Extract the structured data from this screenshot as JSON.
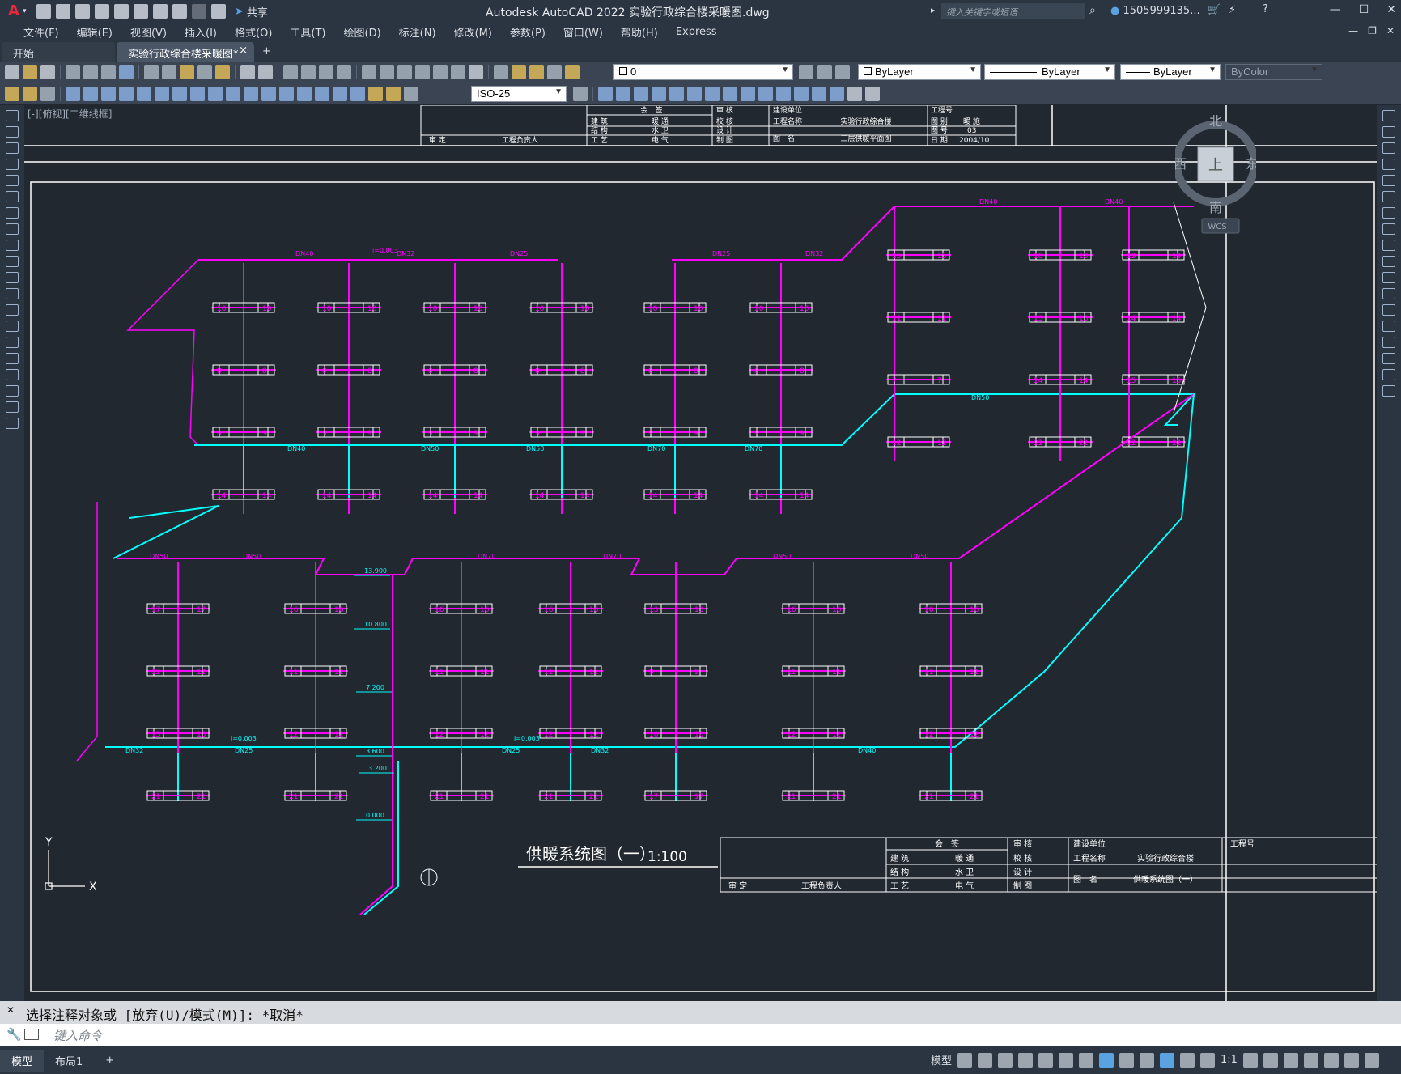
{
  "app": {
    "title": "Autodesk AutoCAD 2022    实验行政综合楼采暖图.dwg",
    "share_label": "共享",
    "search_placeholder": "键入关键字或短语",
    "user": "1505999135...",
    "logo": "A"
  },
  "menu": [
    "文件(F)",
    "编辑(E)",
    "视图(V)",
    "插入(I)",
    "格式(O)",
    "工具(T)",
    "绘图(D)",
    "标注(N)",
    "修改(M)",
    "参数(P)",
    "窗口(W)",
    "帮助(H)",
    "Express"
  ],
  "tabs": {
    "start": "开始",
    "active": "实验行政综合楼采暖图*",
    "close": "×",
    "new": "+"
  },
  "props": {
    "layer": "0",
    "color": "ByLayer",
    "linetype": "ByLayer",
    "lineweight": "ByLayer",
    "plotstyle": "ByColor",
    "dimstyle": "ISO-25"
  },
  "viewport_label": "[-][俯视][二维线框]",
  "viewcube": {
    "north": "北",
    "south": "南",
    "east": "东",
    "west": "西",
    "top": "上",
    "wcs": "WCS"
  },
  "drawing": {
    "main_title": "供暖系统图（一）",
    "scale": "1:100",
    "title_block_top": {
      "hui_qian": "会　签",
      "jian_zhu": "建 筑",
      "nuan_tong": "暖 通",
      "jie_gou": "结 构",
      "shui_wei": "水 卫",
      "gong_yi": "工 艺",
      "dian_qi": "电 气",
      "shen_ding": "审 定",
      "gc_fuzeren": "工程负责人",
      "shen_he": "审 核",
      "jiao_he": "校 核",
      "she_ji": "设 计",
      "zhi_tu": "制 图",
      "jianshe_danwei": "建设单位",
      "gongcheng_mingcheng": "工程名称",
      "tu_ming": "图　名",
      "project_name": "实验行政综合楼",
      "drawing_name": "三层供暖平面图",
      "gongcheng_hao": "工程号",
      "tu_bie": "图 别",
      "tu_bie_val": "暖 施",
      "tu_hao": "图 号",
      "tu_hao_val": "03",
      "ri_qi": "日 期",
      "ri_qi_val": "2004/10"
    },
    "title_block_bottom": {
      "project_name": "实验行政综合楼",
      "drawing_name": "供暖系统图（一）"
    },
    "elevations": [
      "13.900",
      "10.800",
      "7.200",
      "3.600",
      "3.200",
      "0.000"
    ],
    "pipe_labels": [
      "DN40",
      "DN32",
      "DN25",
      "DN50",
      "DN70",
      "DN20",
      "i=0.003"
    ],
    "ucs_y": "Y",
    "ucs_x": "X"
  },
  "cmd": {
    "history": "选择注释对象或 [放弃(U)/模式(M)]: *取消*",
    "placeholder": "键入命令"
  },
  "status": {
    "model_tab": "模型",
    "layout_tab": "布局1",
    "add_tab": "+",
    "model_label": "模型",
    "scale": "1:1"
  },
  "colors": {
    "supply": "#ff00ff",
    "return": "#00ffff",
    "frame": "#ffffff",
    "background": "#212830"
  }
}
